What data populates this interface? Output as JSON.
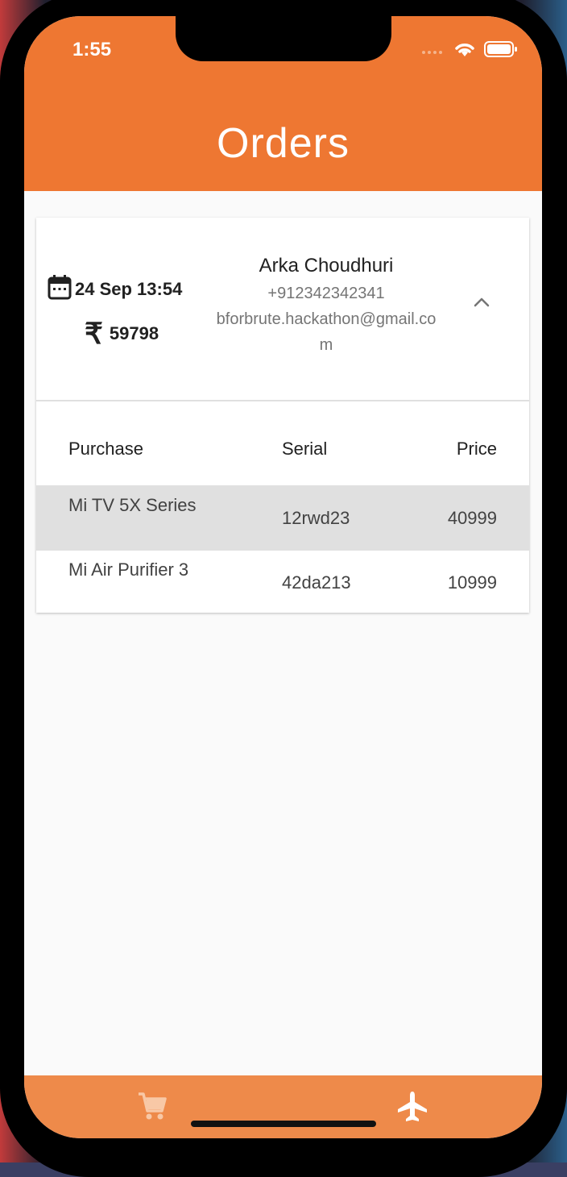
{
  "status_bar": {
    "time": "1:55"
  },
  "app_bar": {
    "title": "Orders"
  },
  "order": {
    "date": "24 Sep 13:54",
    "amount": "59798",
    "currency_symbol": "₹",
    "customer": {
      "name": "Arka Choudhuri",
      "phone": "+912342342341",
      "email": "bforbrute.hackathon@gmail.com"
    },
    "table": {
      "headers": [
        "Purchase",
        "Serial",
        "Price"
      ],
      "rows": [
        {
          "purchase": "Mi TV 5X Series",
          "serial": "12rwd23",
          "price": "40999"
        },
        {
          "purchase": "Mi Air Purifier 3",
          "serial": "42da213",
          "price": "10999"
        }
      ]
    }
  },
  "bottom_nav": {
    "items": [
      {
        "icon": "cart-icon"
      },
      {
        "icon": "airplane-icon"
      }
    ]
  },
  "colors": {
    "accent": "#ee7732",
    "bottom_nav": "#ee8a4a",
    "selected_row": "#e0e0e0"
  }
}
